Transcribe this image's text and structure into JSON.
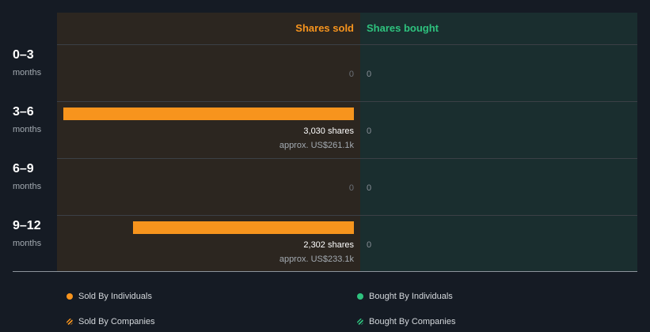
{
  "colors": {
    "sold": "#f7941d",
    "bought": "#2ec27e",
    "panel_sold": "#2c2620",
    "panel_bought": "#1a2e2f",
    "background": "#151b24"
  },
  "headers": {
    "sold": "Shares sold",
    "bought": "Shares bought"
  },
  "legend": {
    "sold_individuals": "Sold By Individuals",
    "bought_individuals": "Bought By Individuals",
    "sold_companies": "Sold By Companies",
    "bought_companies": "Bought By Companies"
  },
  "chart_data": {
    "type": "bar",
    "categories": [
      "0–3",
      "3–6",
      "6–9",
      "9–12"
    ],
    "category_unit": "months",
    "series": [
      {
        "name": "Shares sold",
        "values": [
          0,
          3030,
          0,
          2302
        ],
        "labels": [
          "0",
          "3,030 shares",
          "0",
          "2,302 shares"
        ],
        "approx": [
          "",
          "approx. US$261.1k",
          "",
          "approx. US$233.1k"
        ]
      },
      {
        "name": "Shares bought",
        "values": [
          0,
          0,
          0,
          0
        ],
        "labels": [
          "0",
          "0",
          "0",
          "0"
        ]
      }
    ]
  }
}
